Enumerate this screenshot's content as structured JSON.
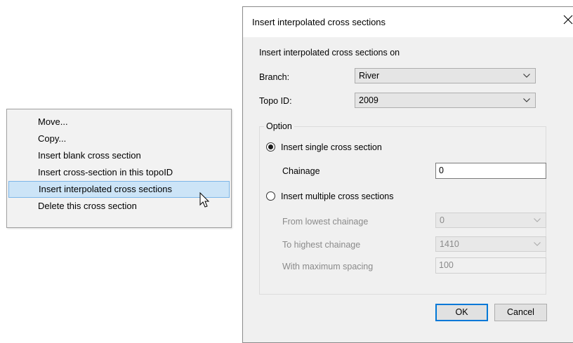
{
  "context_menu": {
    "items": [
      {
        "label": "Move..."
      },
      {
        "label": "Copy..."
      },
      {
        "label": "Insert blank cross section"
      },
      {
        "label": "Insert cross-section in this topoID"
      },
      {
        "label": "Insert interpolated cross sections",
        "highlighted": true
      },
      {
        "label": "Delete this cross section"
      }
    ]
  },
  "dialog": {
    "title": "Insert interpolated cross sections",
    "heading": "Insert interpolated cross sections on",
    "branch": {
      "label": "Branch:",
      "value": "River"
    },
    "topo_id": {
      "label": "Topo ID:",
      "value": "2009"
    },
    "option": {
      "legend": "Option",
      "single": {
        "label": "Insert single cross section",
        "selected": true
      },
      "chainage": {
        "label": "Chainage",
        "value": "0"
      },
      "multiple": {
        "label": "Insert multiple cross sections",
        "selected": false
      },
      "from_lowest": {
        "label": "From lowest chainage",
        "value": "0"
      },
      "to_highest": {
        "label": "To highest chainage",
        "value": "1410"
      },
      "max_spacing": {
        "label": "With maximum spacing",
        "value": "100"
      }
    },
    "ok_label": "OK",
    "cancel_label": "Cancel"
  },
  "colors": {
    "highlight": "#cce4f7",
    "highlight_border": "#7db6e8",
    "accent": "#0078d7",
    "dialog_bg": "#f0f0f0"
  }
}
